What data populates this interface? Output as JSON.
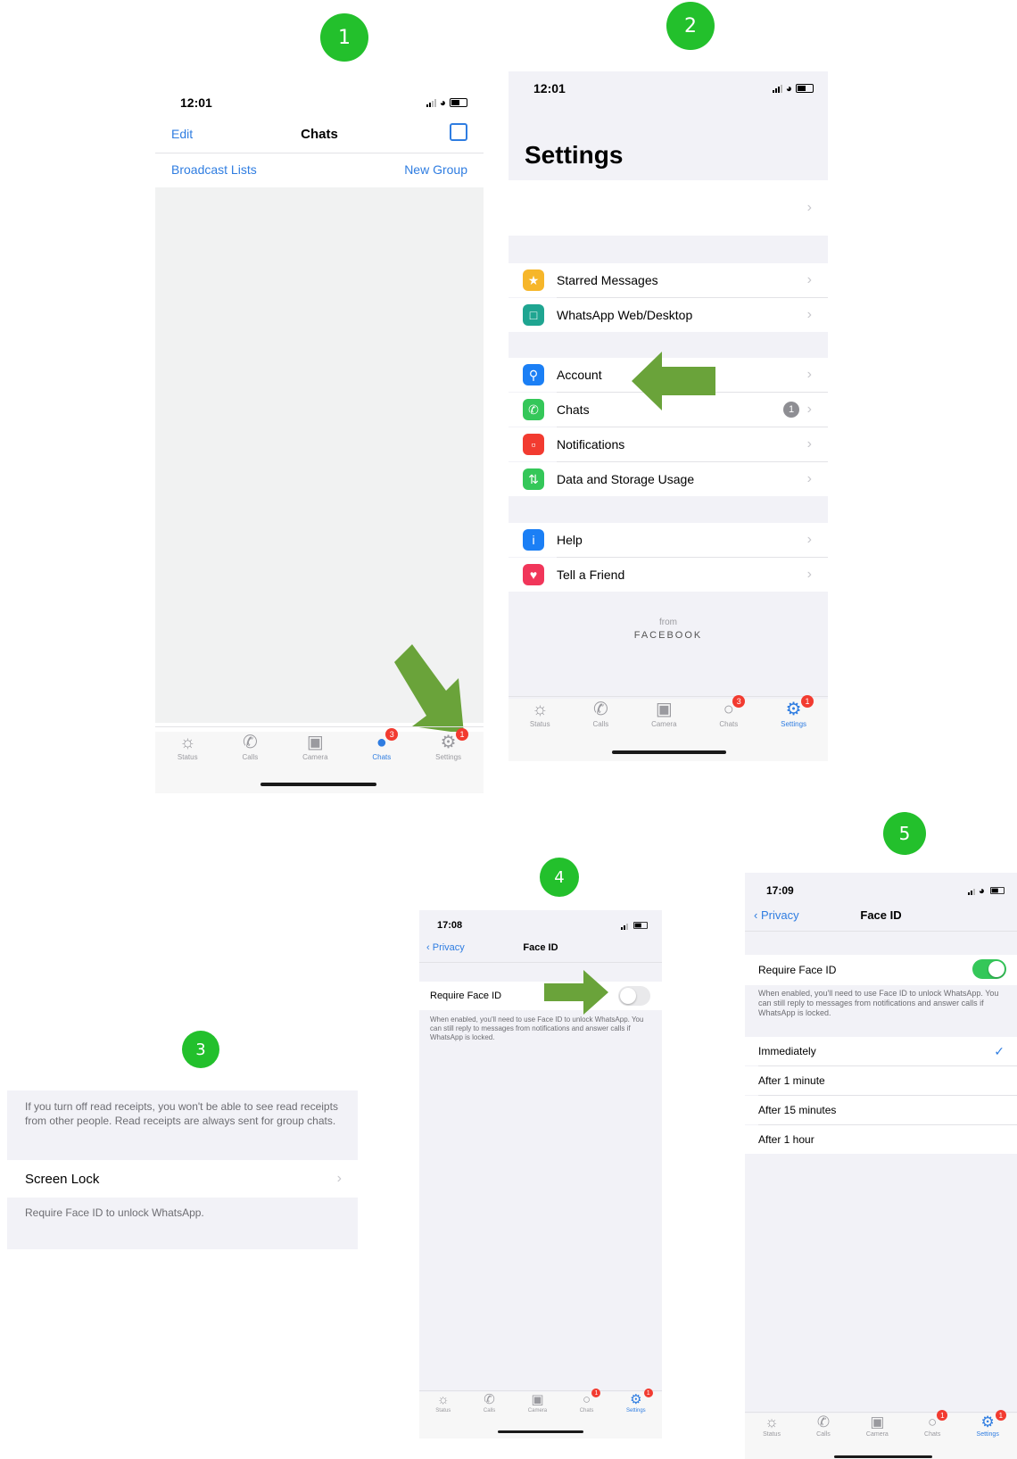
{
  "steps": [
    "1",
    "2",
    "3",
    "4",
    "5"
  ],
  "colors": {
    "step": "#23c02c",
    "arrow": "#6aa33a",
    "link": "#2f7de1",
    "toggle_on": "#34c759",
    "badge": "#f23b30"
  },
  "screen1": {
    "time": "12:01",
    "edit": "Edit",
    "title": "Chats",
    "compose_icon": "compose-icon",
    "broadcast": "Broadcast Lists",
    "new_group": "New Group",
    "tabs": [
      {
        "label": "Status",
        "icon": "status-icon"
      },
      {
        "label": "Calls",
        "icon": "calls-icon"
      },
      {
        "label": "Camera",
        "icon": "camera-icon"
      },
      {
        "label": "Chats",
        "icon": "chats-icon",
        "badge": "3"
      },
      {
        "label": "Settings",
        "icon": "settings-icon",
        "badge": "1"
      }
    ]
  },
  "screen2": {
    "time": "12:01",
    "title": "Settings",
    "group1": [
      {
        "label": "Starred Messages",
        "icon": "star-icon",
        "color": "#f6b62a"
      },
      {
        "label": "WhatsApp Web/Desktop",
        "icon": "laptop-icon",
        "color": "#1fa591"
      }
    ],
    "group2": [
      {
        "label": "Account",
        "icon": "key-icon",
        "color": "#1b7ff5"
      },
      {
        "label": "Chats",
        "icon": "whatsapp-icon",
        "color": "#34c759",
        "count": "1"
      },
      {
        "label": "Notifications",
        "icon": "notification-icon",
        "color": "#f23b30"
      },
      {
        "label": "Data and Storage Usage",
        "icon": "data-icon",
        "color": "#34c759"
      }
    ],
    "group3": [
      {
        "label": "Help",
        "icon": "info-icon",
        "color": "#1b7ff5"
      },
      {
        "label": "Tell a Friend",
        "icon": "heart-icon",
        "color": "#f1365a"
      }
    ],
    "from": "from",
    "facebook": "FACEBOOK",
    "tabs": [
      {
        "label": "Status",
        "icon": "status-icon"
      },
      {
        "label": "Calls",
        "icon": "calls-icon"
      },
      {
        "label": "Camera",
        "icon": "camera-icon"
      },
      {
        "label": "Chats",
        "icon": "chats-icon",
        "badge": "3"
      },
      {
        "label": "Settings",
        "icon": "settings-icon",
        "badge": "1"
      }
    ]
  },
  "screen3": {
    "note": "If you turn off read receipts, you won't be able to see read receipts from other people. Read receipts are always sent for group chats.",
    "screen_lock": "Screen Lock",
    "require": "Require Face ID to unlock WhatsApp."
  },
  "screen4": {
    "time": "17:08",
    "back": "Privacy",
    "title": "Face ID",
    "require": "Require Face ID",
    "toggle_on": false,
    "desc": "When enabled, you'll need to use Face ID to unlock WhatsApp. You can still reply to messages from notifications and answer calls if WhatsApp is locked.",
    "tabs": [
      {
        "label": "Status",
        "icon": "status-icon"
      },
      {
        "label": "Calls",
        "icon": "calls-icon"
      },
      {
        "label": "Camera",
        "icon": "camera-icon"
      },
      {
        "label": "Chats",
        "icon": "chats-icon",
        "badge": "1"
      },
      {
        "label": "Settings",
        "icon": "settings-icon",
        "badge": "1"
      }
    ]
  },
  "screen5": {
    "time": "17:09",
    "back": "Privacy",
    "title": "Face ID",
    "require": "Require Face ID",
    "toggle_on": true,
    "desc": "When enabled, you'll need to use Face ID to unlock WhatsApp. You can still reply to messages from notifications and answer calls if WhatsApp is locked.",
    "options": [
      "Immediately",
      "After 1 minute",
      "After 15 minutes",
      "After 1 hour"
    ],
    "selected": "Immediately",
    "tabs": [
      {
        "label": "Status",
        "icon": "status-icon"
      },
      {
        "label": "Calls",
        "icon": "calls-icon"
      },
      {
        "label": "Camera",
        "icon": "camera-icon"
      },
      {
        "label": "Chats",
        "icon": "chats-icon",
        "badge": "1"
      },
      {
        "label": "Settings",
        "icon": "settings-icon",
        "badge": "1"
      }
    ]
  }
}
